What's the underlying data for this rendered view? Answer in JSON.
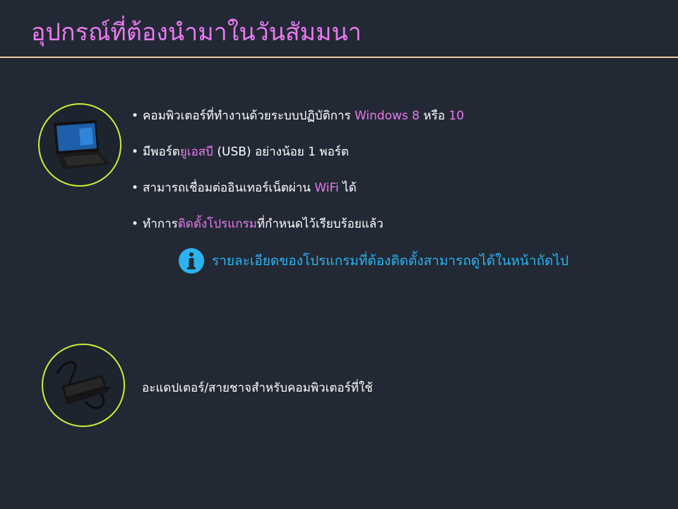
{
  "title": "อุปกรณ์ที่ต้องนำมาในวันสัมมนา",
  "bullets": [
    {
      "before": "คอมพิวเตอร์ที่ทำงานด้วยระบบปฏิบัติการ ",
      "highlight": "Windows 8",
      "middle": " หรือ ",
      "highlight2": "10",
      "after": ""
    },
    {
      "before": "มีพอร์ต",
      "highlight": "ยูเอสบี",
      "after": " (USB) อย่างน้อย 1 พอร์ต"
    },
    {
      "before": "สามารถเชื่อมต่ออินเทอร์เน็ตผ่าน ",
      "highlight": "WiFi",
      "after": " ได้"
    },
    {
      "before": "ทำการ",
      "highlight": "ติดตั้งโปรแกรม",
      "after": "ที่กำหนดไว้เรียบร้อยแล้ว"
    }
  ],
  "bullet_char": "•",
  "info": {
    "icon": "info-icon",
    "text": "รายละเอียดของโปรแกรมที่ต้องติดตั้งสามารถดูได้ในหน้าถัดไป"
  },
  "adapter": {
    "text": "อะแดปเตอร์/สายชาจสำหรับคอมพิวเตอร์ที่ใช้"
  },
  "colors": {
    "background": "#222934",
    "title": "#e879f0",
    "highlight": "#e879f0",
    "info": "#2bb3f0",
    "circle": "#c6f038",
    "rule": "#f2c8a4"
  }
}
